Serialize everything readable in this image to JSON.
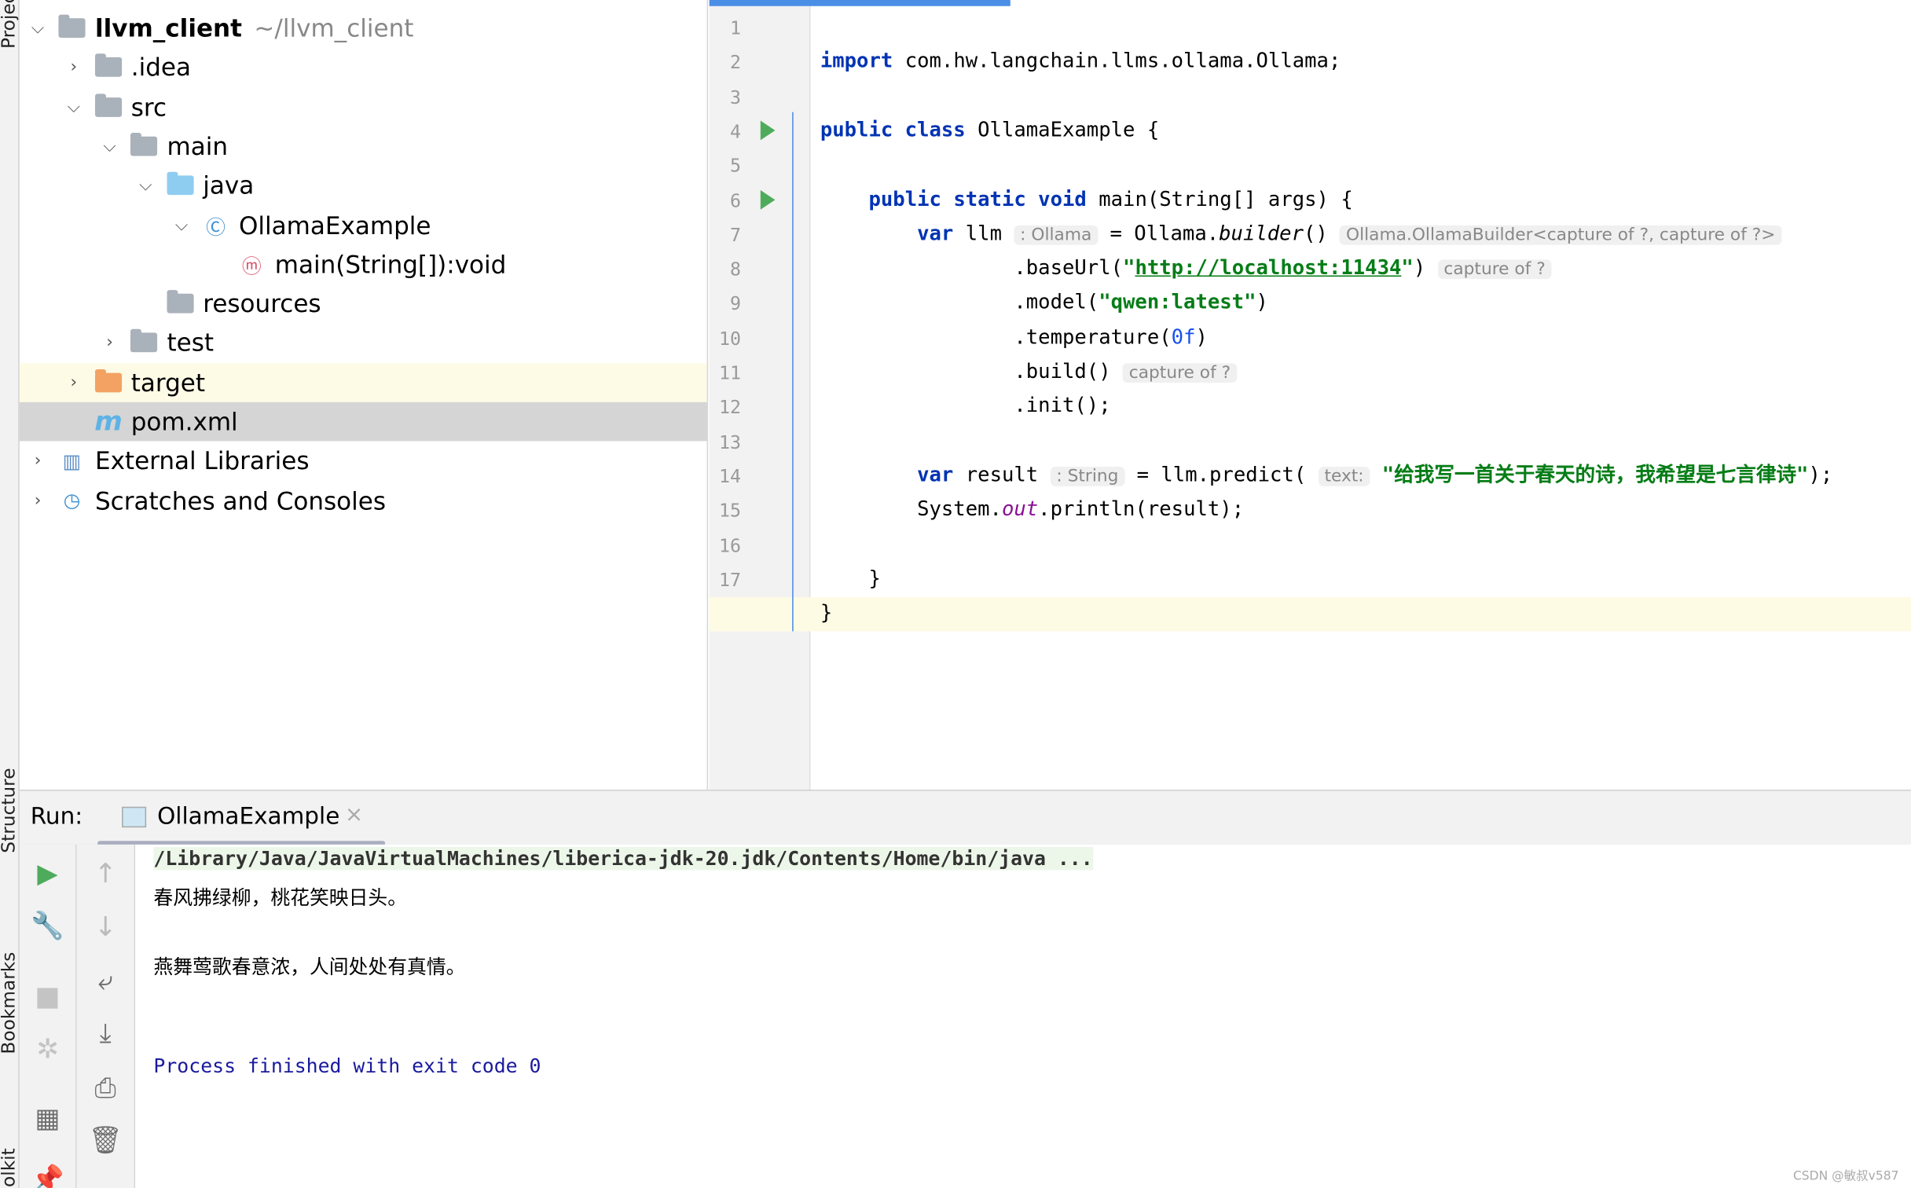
{
  "side_tabs": [
    "Project",
    "Structure",
    "Bookmarks",
    "Toolkit"
  ],
  "project_tree": [
    {
      "label": "llvm_client",
      "extra": "~/llvm_client",
      "depth": 0,
      "chevron": "down",
      "icon": "module-folder-icon",
      "bold": true
    },
    {
      "label": ".idea",
      "depth": 1,
      "chevron": "right",
      "icon": "folder-icon"
    },
    {
      "label": "src",
      "depth": 1,
      "chevron": "down",
      "icon": "folder-icon"
    },
    {
      "label": "main",
      "depth": 2,
      "chevron": "down",
      "icon": "folder-icon"
    },
    {
      "label": "java",
      "depth": 3,
      "chevron": "down",
      "icon": "source-folder-icon"
    },
    {
      "label": "OllamaExample",
      "depth": 4,
      "chevron": "down",
      "icon": "java-class-icon"
    },
    {
      "label": "main(String[]):void",
      "depth": 5,
      "chevron": "",
      "icon": "method-icon"
    },
    {
      "label": "resources",
      "depth": 3,
      "chevron": "",
      "icon": "resources-folder-icon"
    },
    {
      "label": "test",
      "depth": 2,
      "chevron": "right",
      "icon": "folder-icon"
    },
    {
      "label": "target",
      "depth": 1,
      "chevron": "right",
      "icon": "excluded-folder-icon",
      "state": "highlight"
    },
    {
      "label": "pom.xml",
      "depth": 1,
      "chevron": "",
      "icon": "maven-icon",
      "state": "selected"
    },
    {
      "label": "External Libraries",
      "depth": 0,
      "chevron": "right",
      "icon": "libraries-icon"
    },
    {
      "label": "Scratches and Consoles",
      "depth": 0,
      "chevron": "right",
      "icon": "scratches-icon"
    }
  ],
  "editor": {
    "lines": [
      [],
      [
        {
          "t": "import ",
          "c": "kw"
        },
        {
          "t": "com.hw.langchain.llms.ollama.Ollama;"
        }
      ],
      [],
      [
        {
          "t": "public class ",
          "c": "kw"
        },
        {
          "t": "OllamaExample "
        },
        {
          "t": "{"
        }
      ],
      [],
      [
        {
          "t": "    "
        },
        {
          "t": "public static void ",
          "c": "kw"
        },
        {
          "t": "main(String[] args) {"
        }
      ],
      [
        {
          "t": "        "
        },
        {
          "t": "var ",
          "c": "kw"
        },
        {
          "t": "llm "
        },
        {
          "t": ": Ollama",
          "c": "hint"
        },
        {
          "t": " = Ollama."
        },
        {
          "t": "builder",
          "c": "ital"
        },
        {
          "t": "() "
        },
        {
          "t": "Ollama.OllamaBuilder<capture of ?, capture of ?>",
          "c": "hint"
        }
      ],
      [
        {
          "t": "                .baseUrl("
        },
        {
          "t": "\"",
          "c": "str"
        },
        {
          "t": "http://localhost:11434",
          "c": "link"
        },
        {
          "t": "\"",
          "c": "str"
        },
        {
          "t": ") "
        },
        {
          "t": "capture of ?",
          "c": "hint"
        }
      ],
      [
        {
          "t": "                .model("
        },
        {
          "t": "\"qwen:latest\"",
          "c": "str"
        },
        {
          "t": ")"
        }
      ],
      [
        {
          "t": "                .temperature("
        },
        {
          "t": "0f",
          "c": "num"
        },
        {
          "t": ")"
        }
      ],
      [
        {
          "t": "                .build() "
        },
        {
          "t": "capture of ?",
          "c": "hint"
        }
      ],
      [
        {
          "t": "                .init();"
        }
      ],
      [],
      [
        {
          "t": "        "
        },
        {
          "t": "var ",
          "c": "kw"
        },
        {
          "t": "result "
        },
        {
          "t": ": String",
          "c": "hint"
        },
        {
          "t": " = llm.predict( "
        },
        {
          "t": "text:",
          "c": "hint"
        },
        {
          "t": " "
        },
        {
          "t": "\"给我写一首关于春天的诗，我希望是七言律诗\"",
          "c": "str"
        },
        {
          "t": ");"
        }
      ],
      [
        {
          "t": "        System."
        },
        {
          "t": "out",
          "c": "ital2"
        },
        {
          "t": ".println(result);"
        }
      ],
      [],
      [
        {
          "t": "    }"
        }
      ],
      [
        {
          "t": "}"
        }
      ]
    ],
    "run_markers": [
      4,
      6
    ],
    "current_line": 18
  },
  "run": {
    "label": "Run:",
    "tab": "OllamaExample",
    "console": [
      {
        "text": "/Library/Java/JavaVirtualMachines/liberica-jdk-20.jdk/Contents/Home/bin/java ...",
        "kind": "cmd"
      },
      {
        "text": "春风拂绿柳，桃花笑映日头。",
        "kind": "out"
      },
      {
        "text": "",
        "kind": "out"
      },
      {
        "text": "燕舞莺歌春意浓，人间处处有真情。",
        "kind": "out"
      },
      {
        "text": "",
        "kind": "out"
      },
      {
        "text": "",
        "kind": "out"
      },
      {
        "text": "Process finished with exit code 0",
        "kind": "exit"
      }
    ],
    "toolbar_left": [
      "rerun-icon",
      "wrench-icon",
      "stop-icon",
      "debug-icon",
      "layout-icon",
      "pin-icon"
    ],
    "toolbar_right": [
      "arrow-up-icon",
      "arrow-down-icon",
      "soft-wrap-icon",
      "scroll-to-end-icon",
      "print-icon",
      "trash-icon"
    ]
  },
  "watermark": "CSDN @敏叔v587",
  "colors": {
    "keyword": "#0033b3",
    "string": "#067d17",
    "run": "#4fab5c",
    "accent": "#4a8ee6"
  }
}
